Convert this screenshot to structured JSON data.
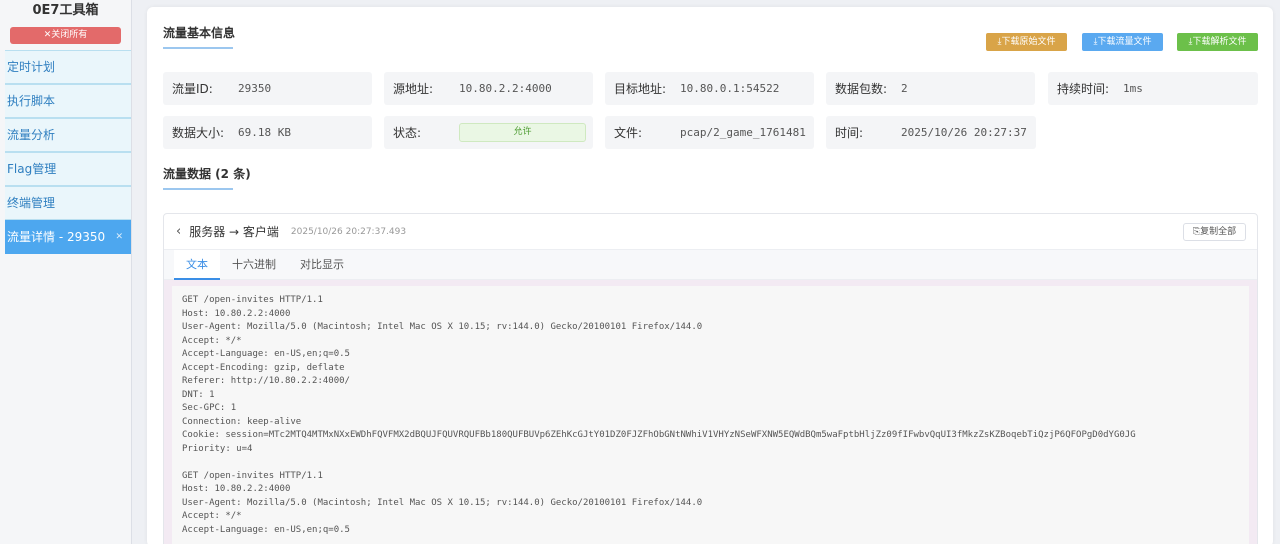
{
  "sidebar": {
    "title": "0E7工具箱",
    "close_all": "✕关闭所有",
    "items": [
      {
        "label": "定时计划"
      },
      {
        "label": "执行脚本"
      },
      {
        "label": "流量分析"
      },
      {
        "label": "Flag管理"
      },
      {
        "label": "终端管理"
      },
      {
        "label": "流量详情 - 29350",
        "close": "✕"
      }
    ]
  },
  "info_section": {
    "title": "流量基本信息",
    "buttons": {
      "download_raw": "⤓下载原始文件",
      "download_flow": "⤓下载流量文件",
      "download_parsed": "⤓下载解析文件"
    },
    "button_colors": {
      "raw": "#d9a448",
      "flow": "#5aa9f0",
      "parsed": "#6cc04a"
    },
    "fields": {
      "flow_id": {
        "label": "流量ID:",
        "value": "29350"
      },
      "src": {
        "label": "源地址:",
        "value": "10.80.2.2:4000"
      },
      "dst": {
        "label": "目标地址:",
        "value": "10.80.0.1:54522"
      },
      "packets": {
        "label": "数据包数:",
        "value": "2"
      },
      "duration": {
        "label": "持续时间:",
        "value": "1ms"
      },
      "size": {
        "label": "数据大小:",
        "value": "69.18 KB"
      },
      "status": {
        "label": "状态:",
        "value": "允许"
      },
      "file": {
        "label": "文件:",
        "value": "pcap/2_game_1761481"
      },
      "time": {
        "label": "时间:",
        "value": "2025/10/26 20:27:37"
      }
    }
  },
  "data_section": {
    "title": "流量数据 (2 条)",
    "panel": {
      "direction": "服务器 → 客户端",
      "timestamp": "2025/10/26 20:27:37.493",
      "copy_all": "⎘复制全部",
      "tabs": [
        "文本",
        "十六进制",
        "对比显示"
      ],
      "content": "GET /open-invites HTTP/1.1\nHost: 10.80.2.2:4000\nUser-Agent: Mozilla/5.0 (Macintosh; Intel Mac OS X 10.15; rv:144.0) Gecko/20100101 Firefox/144.0\nAccept: */*\nAccept-Language: en-US,en;q=0.5\nAccept-Encoding: gzip, deflate\nReferer: http://10.80.2.2:4000/\nDNT: 1\nSec-GPC: 1\nConnection: keep-alive\nCookie: session=MTc2MTQ4MTMxNXxEWDhFQVFMX2dBQUJFQUVRQUFBb180QUFBUVp6ZEhKcGJtY01DZ0FJZFhObGNtNWhiV1VHYzNSeWFXNW5EQWdBQm5waFptbHljZz09fIFwbvQqUI3fMkzZsKZBoqebTiQzjP6QFOPgD0dYG0JG\nPriority: u=4\n\nGET /open-invites HTTP/1.1\nHost: 10.80.2.2:4000\nUser-Agent: Mozilla/5.0 (Macintosh; Intel Mac OS X 10.15; rv:144.0) Gecko/20100101 Firefox/144.0\nAccept: */*\nAccept-Language: en-US,en;q=0.5"
    }
  }
}
